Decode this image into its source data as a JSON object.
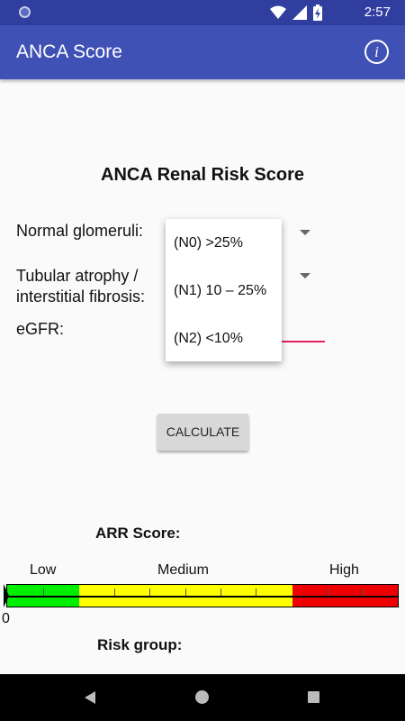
{
  "status_bar": {
    "time": "2:57",
    "icons": [
      "wifi-icon",
      "cell-signal-icon",
      "battery-charging-icon"
    ]
  },
  "app_bar": {
    "title": "ANCA Score",
    "info_icon": "i"
  },
  "form": {
    "title": "ANCA Renal Risk Score",
    "normal_glomeruli_label": "Normal glomeruli:",
    "tubular_label_line1": "Tubular atrophy /",
    "tubular_label_line2": "interstitial fibrosis:",
    "egfr_label": "eGFR:"
  },
  "dropdown": {
    "options": [
      "(N0) >25%",
      "(N1) 10 – 25%",
      "(N2) <10%"
    ]
  },
  "calculate_button": "CALCULATE",
  "result": {
    "arr_score_label": "ARR Score:",
    "scale": {
      "low_label": "Low",
      "medium_label": "Medium",
      "high_label": "High",
      "zero_label": "0",
      "colors": {
        "low": "#00ee00",
        "medium": "#ffff00",
        "high": "#ee0000"
      }
    },
    "risk_group_label": "Risk group:"
  },
  "colors": {
    "primary": "#3f51b5",
    "primary_dark": "#303f9f",
    "accent": "#e91e63"
  }
}
